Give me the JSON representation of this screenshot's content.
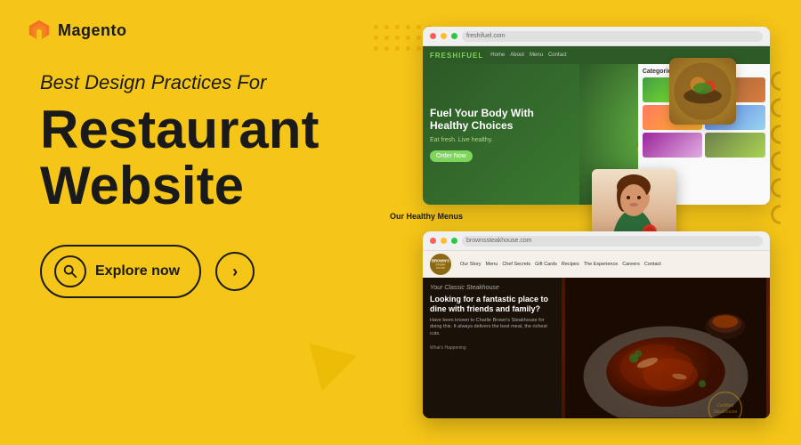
{
  "brand": {
    "logo_text": "Magento",
    "logo_alt": "Magento logo"
  },
  "hero": {
    "subtitle": "Best Design Practices For",
    "title_line1": "Restaurant",
    "title_line2": "Website"
  },
  "buttons": {
    "explore_label": "Explore now",
    "arrow_icon": "›"
  },
  "screenshots": {
    "top": {
      "brand": "FRESHIFUEL",
      "title": "Fuel Your Body With Healthy Choices",
      "subtitle": "Eat fresh. Live healthy.",
      "cta": "Order Now",
      "categories_title": "Categories",
      "url_text": "freshifuel.com"
    },
    "bottom": {
      "brand": "BROWN'S STEAKHOUSE",
      "tagline": "Your Classic Steakhouse",
      "nav_items": [
        "Our Story",
        "Menu",
        "Chef Secrets",
        "Gift Cards",
        "Recipes",
        "The Experience",
        "Careers",
        "Contact"
      ],
      "left_title": "Looking for a fantastic place to dine with friends and family?",
      "left_text": "Have been known to Charlie Brown's Steakhouse for doing this. It always delivers the best meat, the richest cuts.",
      "section_label": "What's Happening"
    },
    "person_label": "Our Healthy Menus"
  },
  "decorations": {
    "dots_count": 18,
    "circles_count": 6,
    "accent_color": "#e8a800"
  }
}
